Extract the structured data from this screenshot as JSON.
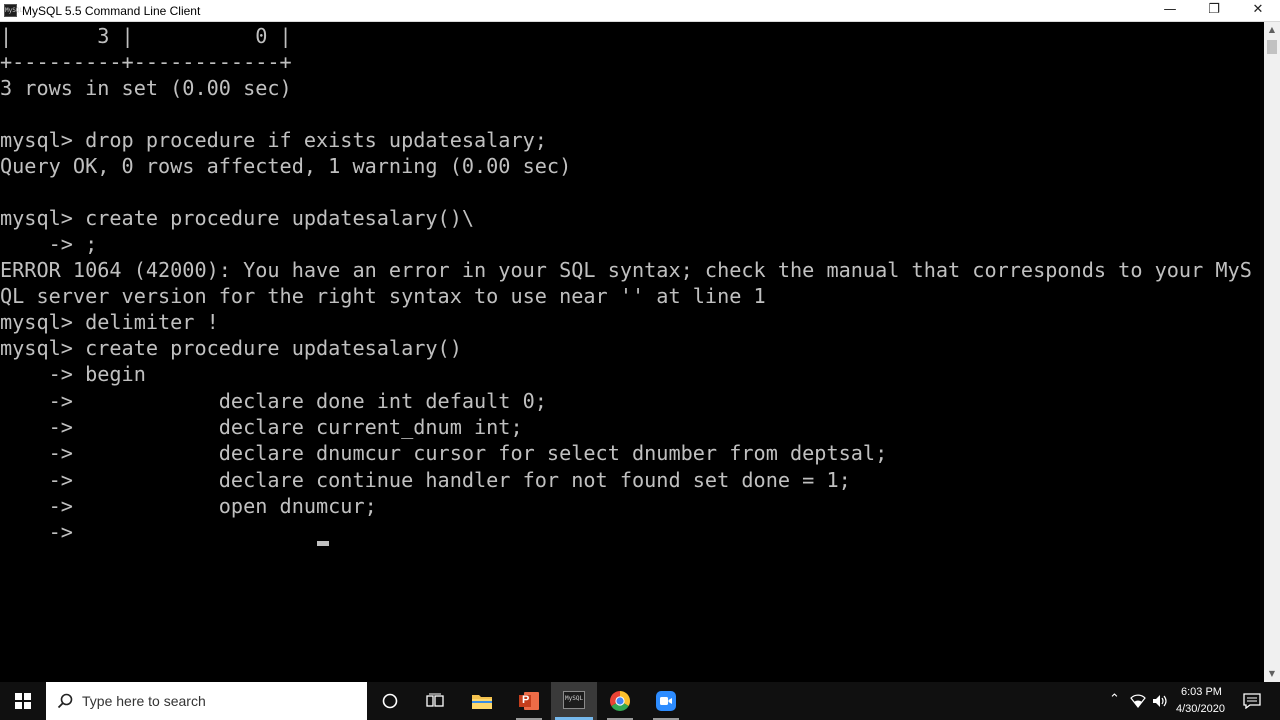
{
  "window": {
    "title": "MySQL 5.5 Command Line Client",
    "app_icon_text": "MySQL",
    "minimize_glyph": "—",
    "restore_glyph": "❐",
    "close_glyph": "✕"
  },
  "console": {
    "lines": [
      "|       3 |          0 |",
      "+---------+------------+",
      "3 rows in set (0.00 sec)",
      "",
      "mysql> drop procedure if exists updatesalary;",
      "Query OK, 0 rows affected, 1 warning (0.00 sec)",
      "",
      "mysql> create procedure updatesalary()\\",
      "    -> ;",
      "ERROR 1064 (42000): You have an error in your SQL syntax; check the manual that corresponds to your MyS",
      "QL server version for the right syntax to use near '' at line 1",
      "mysql> delimiter !",
      "mysql> create procedure updatesalary()",
      "    -> begin",
      "    ->            declare done int default 0;",
      "    ->            declare current_dnum int;",
      "    ->            declare dnumcur cursor for select dnumber from deptsal;",
      "    ->            declare continue handler for not found set done = 1;",
      "    ->            open dnumcur;",
      "    ->"
    ]
  },
  "scrollbar": {
    "up_glyph": "▲",
    "down_glyph": "▼"
  },
  "taskbar": {
    "search_placeholder": "Type here to search",
    "task_view_glyph": "⧉",
    "cortana_glyph": "○",
    "mysql_icon_text": "MySQL",
    "powerpoint_letter": "P",
    "tray_chevron": "⌃",
    "wifi_glyph": "◔",
    "volume_glyph": "🔊",
    "notification_glyph": "▭",
    "time": "6:03 PM",
    "date": "4/30/2020"
  },
  "colors": {
    "console_bg": "#000000",
    "console_fg": "#c0c0c0",
    "taskbar_bg": "#101010",
    "accent": "#76b9ed"
  }
}
